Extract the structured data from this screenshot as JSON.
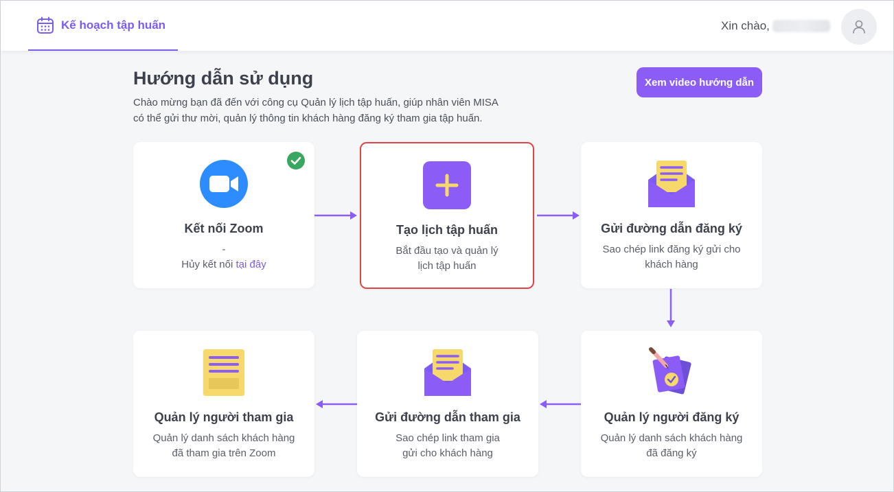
{
  "header": {
    "nav_label": "Kế hoạch tập huấn",
    "greeting": "Xin chào,"
  },
  "intro": {
    "title": "Hướng dẫn sử dụng",
    "desc_line1": "Chào mừng bạn đã đến với công cụ Quản lý lịch tập huấn, giúp nhân viên MISA",
    "desc_line2": "có thể gửi thư mời, quản lý thông tin khách hàng đăng ký tham gia tập huấn.",
    "video_button": "Xem video hướng dẫn"
  },
  "colors": {
    "accent": "#8b5cf6",
    "zoom_blue": "#2d8cff",
    "check_green": "#3aa760",
    "paper_yellow": "#f7d96b",
    "highlight_red": "#e04545"
  },
  "cards": {
    "zoom": {
      "icon": "zoom-camera-icon",
      "title": "Kết nối Zoom",
      "dash": "-",
      "unlink_prefix": "Hủy kết nối ",
      "unlink_link": "tại đây"
    },
    "create": {
      "icon": "plus-icon",
      "title": "Tạo lịch tập huấn",
      "line1": "Bắt đầu tạo và quản lý",
      "line2": "lịch tập huấn"
    },
    "send_reg": {
      "icon": "envelope-icon",
      "title": "Gửi đường dẫn đăng ký",
      "line1": "Sao chép link đăng ký gửi cho",
      "line2": "khách hàng"
    },
    "manage_reg": {
      "icon": "signed-document-icon",
      "title": "Quản lý người đăng ký",
      "line1": "Quản lý danh sách khách hàng",
      "line2": "đã đăng ký"
    },
    "send_join": {
      "icon": "envelope-icon",
      "title": "Gửi đường dẫn tham gia",
      "line1": "Sao chép link tham gia",
      "line2": "gửi cho khách hàng"
    },
    "manage_join": {
      "icon": "document-list-icon",
      "title": "Quản lý người tham gia",
      "line1": "Quản lý danh sách khách hàng",
      "line2": "đã tham gia trên Zoom"
    }
  }
}
